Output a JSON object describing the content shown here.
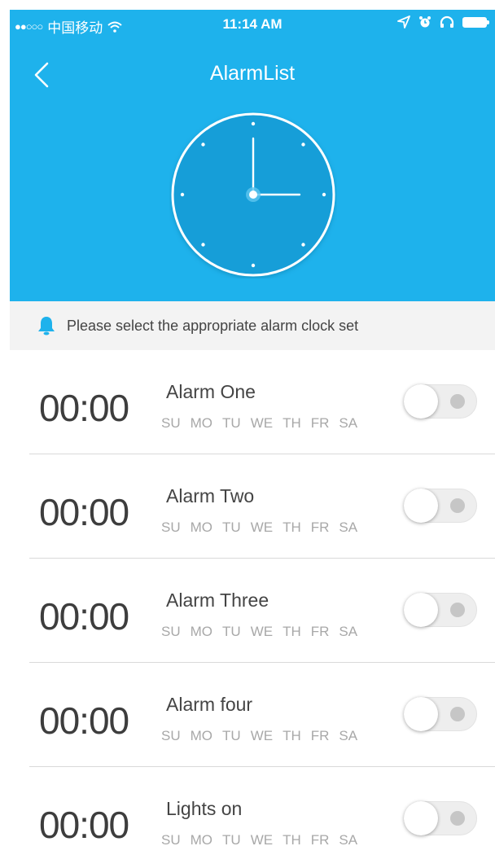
{
  "status_bar": {
    "carrier_signal": "●●○○○",
    "carrier": "中国移动",
    "time": "11:14 AM",
    "icons": [
      "wifi-icon",
      "location-arrow-icon",
      "alarm-icon",
      "headphones-icon",
      "battery-icon"
    ]
  },
  "nav": {
    "title": "AlarmList",
    "back_icon": "chevron-left-icon"
  },
  "colors": {
    "header_bg": "#1eb2ec",
    "clock_face": "#189ed8",
    "notice_bg": "#f3f3f3",
    "bell": "#1eb2ec"
  },
  "notice": {
    "icon": "bell-icon",
    "text": "Please select the appropriate alarm clock set"
  },
  "weekdays": [
    "SU",
    "MO",
    "TU",
    "WE",
    "TH",
    "FR",
    "SA"
  ],
  "alarms": [
    {
      "time": "00:00",
      "name": "Alarm One",
      "enabled": false
    },
    {
      "time": "00:00",
      "name": "Alarm Two",
      "enabled": false
    },
    {
      "time": "00:00",
      "name": "Alarm Three",
      "enabled": false
    },
    {
      "time": "00:00",
      "name": "Alarm four",
      "enabled": false
    },
    {
      "time": "00:00",
      "name": "Lights on",
      "enabled": false
    }
  ]
}
